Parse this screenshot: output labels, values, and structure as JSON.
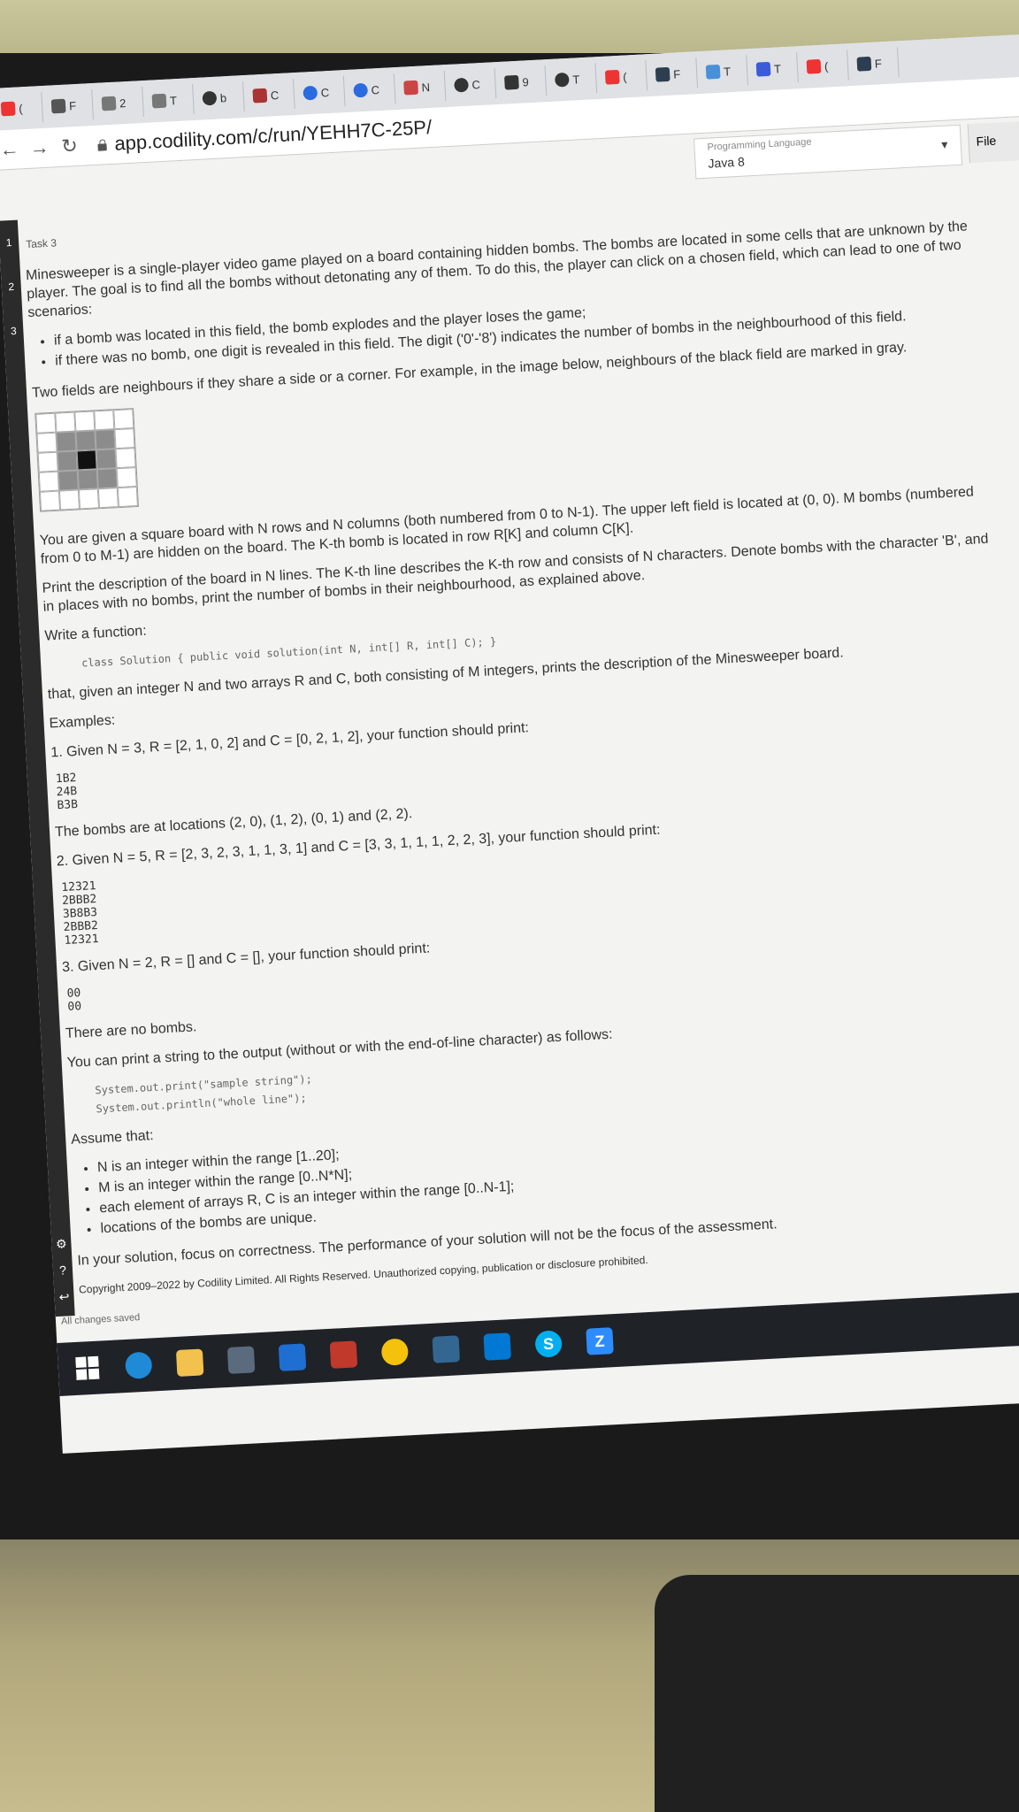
{
  "browser": {
    "tabs": [
      "(",
      "F",
      "2",
      "T",
      "b",
      "C",
      "C",
      "C",
      "N",
      "C",
      "9",
      "T",
      "(",
      "F",
      "T",
      "T",
      "(",
      "F"
    ],
    "url": "app.codility.com/c/run/YEHH7C-25P/"
  },
  "header": {
    "lang_label": "Programming Language",
    "lang_value": "Java 8",
    "file_tab": "File"
  },
  "gutter": {
    "numbers": [
      "1",
      "2",
      "3"
    ]
  },
  "task": {
    "label": "Task 3",
    "intro": "Minesweeper is a single-player video game played on a board containing hidden bombs. The bombs are located in some cells that are unknown by the player. The goal is to find all the bombs without detonating any of them. To do this, the player can click on a chosen field, which can lead to one of two scenarios:",
    "scenarios": [
      "if a bomb was located in this field, the bomb explodes and the player loses the game;",
      "if there was no bomb, one digit is revealed in this field. The digit ('0'-'8') indicates the number of bombs in the neighbourhood of this field."
    ],
    "neighbours": "Two fields are neighbours if they share a side or a corner. For example, in the image below, neighbours of the black field are marked in gray.",
    "board_desc": "You are given a square board with N rows and N columns (both numbered from 0 to N-1). The upper left field is located at (0, 0). M bombs (numbered from 0 to M-1) are hidden on the board. The K-th bomb is located in row R[K] and column C[K].",
    "print_desc": "Print the description of the board in N lines. The K-th line describes the K-th row and consists of N characters. Denote bombs with the character 'B', and in places with no bombs, print the number of bombs in their neighbourhood, as explained above.",
    "write_fn": "Write a function:",
    "signature": "class Solution { public void solution(int N, int[] R, int[] C); }",
    "fn_desc": "that, given an integer N and two arrays R and C, both consisting of M integers, prints the description of the Minesweeper board.",
    "examples_label": "Examples:",
    "ex1": "1. Given N = 3, R = [2, 1, 0, 2] and C = [0, 2, 1, 2], your function should print:",
    "ex1_out": "1B2\n24B\nB3B",
    "ex1_note": "The bombs are at locations (2, 0), (1, 2), (0, 1) and (2, 2).",
    "ex2": "2. Given N = 5, R = [2, 3, 2, 3, 1, 1, 3, 1] and C = [3, 3, 1, 1, 1, 2, 2, 3], your function should print:",
    "ex2_out": "12321\n2BBB2\n3B8B3\n2BBB2\n12321",
    "ex3": "3. Given N = 2, R = [] and C = [], your function should print:",
    "ex3_out": "00\n00",
    "ex3_note": "There are no bombs.",
    "print_note": "You can print a string to the output (without or with the end-of-line character) as follows:",
    "print_code": "System.out.print(\"sample string\");\nSystem.out.println(\"whole line\");",
    "assume": "Assume that:",
    "assumptions": [
      "N is an integer within the range [1..20];",
      "M is an integer within the range [0..N*N];",
      "each element of arrays R, C is an integer within the range [0..N-1];",
      "locations of the bombs are unique."
    ],
    "focus": "In your solution, focus on correctness. The performance of your solution will not be the focus of the assessment.",
    "copyright": "Copyright 2009–2022 by Codility Limited. All Rights Reserved. Unauthorized copying, publication or disclosure prohibited."
  },
  "status": "All changes saved",
  "taskbar": {
    "labels": [
      "S",
      "Z"
    ]
  }
}
